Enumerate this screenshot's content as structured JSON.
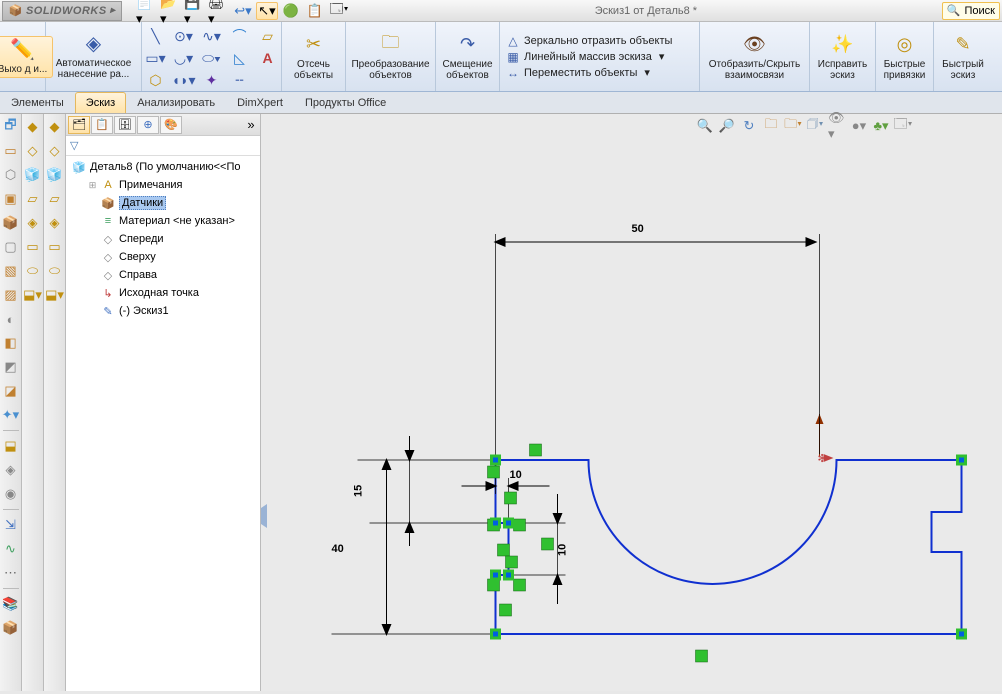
{
  "app_name": "SOLIDWORKS",
  "doc_title": "Эскиз1 от Деталь8 *",
  "search_placeholder": "Поиск",
  "ribbon": {
    "exit_sketch": "Выхо д и...",
    "auto_dim": "Автоматическое нанесение ра...",
    "trim": "Отсечь объекты",
    "convert": "Преобразование объектов",
    "offset": "Смещение объектов",
    "mirror": "Зеркально отразить объекты",
    "linear_pattern": "Линейный массив эскиза",
    "move": "Переместить объекты",
    "show_hide": "Отобразить/Скрыть взаимосвязи",
    "fix_sketch": "Исправить эскиз",
    "quick_snaps": "Быстрые привязки",
    "rapid_sketch": "Быстрый эскиз"
  },
  "tabs": [
    "Элементы",
    "Эскиз",
    "Анализировать",
    "DimXpert",
    "Продукты Office"
  ],
  "active_tab": 1,
  "tree": {
    "root": "Деталь8  (По умолчанию<<По",
    "items": [
      {
        "label": "Примечания",
        "ico": "📄"
      },
      {
        "label": "Датчики",
        "ico": "📦",
        "selected": true
      },
      {
        "label": "Материал <не указан>",
        "ico": "≡"
      },
      {
        "label": "Спереди",
        "ico": "◇"
      },
      {
        "label": "Сверху",
        "ico": "◇"
      },
      {
        "label": "Справа",
        "ico": "◇"
      },
      {
        "label": "Исходная точка",
        "ico": "↳"
      },
      {
        "label": "(-) Эскиз1",
        "ico": "✎"
      }
    ]
  },
  "dims": {
    "d50": "50",
    "d40": "40",
    "d15": "15",
    "d10a": "10",
    "d10b": "10"
  }
}
